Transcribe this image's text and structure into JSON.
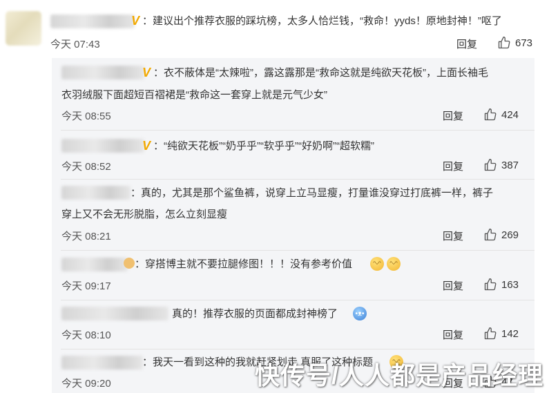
{
  "top_comment": {
    "text": "：建议出个推荐衣服的踩坑榜，太多人恰烂钱，“救命！yyds！原地封神！”呕了",
    "time": "今天 07:43",
    "reply_label": "回复",
    "likes": "673"
  },
  "replies": [
    {
      "lines": [
        "：衣不蔽体是“太辣啦”，露这露那是“救命这就是纯欲天花板”，上面长袖毛",
        "衣羽绒服下面超短百褶裙是“救命这一套穿上就是元气少女”"
      ],
      "time": "今天 08:55",
      "reply_label": "回复",
      "likes": "424"
    },
    {
      "lines": [
        "：“纯欲天花板”“奶乎乎”“软乎乎”“好奶啊”“超软糯”"
      ],
      "time": "今天 08:52",
      "reply_label": "回复",
      "likes": "387"
    },
    {
      "lines": [
        "：真的，尤其是那个鲨鱼裤，说穿上立马显瘦，打量谁没穿过打底裤一样，裤子",
        "穿上又不会无形脱脂，怎么立刻显瘦"
      ],
      "time": "今天 08:21",
      "reply_label": "回复",
      "likes": "269"
    },
    {
      "lines": [
        "：穿搭博主就不要拉腿修图！！！没有参考价值"
      ],
      "time": "今天 09:17",
      "reply_label": "回复",
      "likes": "163"
    },
    {
      "lines": [
        "真的！推荐衣服的页面都成封神榜了"
      ],
      "time": "今天 08:10",
      "reply_label": "回复",
      "likes": "142"
    },
    {
      "lines": [
        "：我天一看到这种的我就赶紧划走 真服了这种标题"
      ],
      "time": "今天 09:20",
      "reply_label": "回复",
      "likes": "47"
    }
  ],
  "watermark": "快传号/人人都是产品经理",
  "colors": {
    "vip": "#f2a900",
    "replies_bg": "#f4f5f7"
  },
  "icons": {
    "like": "thumbs-up-icon",
    "vip": "vip-badge-icon"
  }
}
